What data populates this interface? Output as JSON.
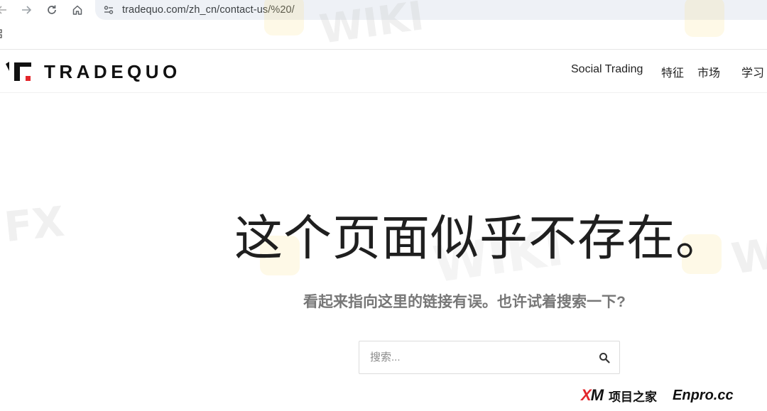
{
  "browser": {
    "url": "tradequo.com/zh_cn/contact-us/%20/",
    "icons": [
      "back-arrow-icon",
      "forward-arrow-icon",
      "reload-icon",
      "home-icon",
      "site-info-icon",
      "apps-grid-icon"
    ]
  },
  "header": {
    "logo_text": "TRADEQUO",
    "nav": {
      "social_trading": "Social Trading",
      "features": "特征",
      "markets": "市场",
      "learn": "学习"
    }
  },
  "main": {
    "headline": "这个页面似乎不存在。",
    "subtext": "看起来指向这里的链接有误。也许试着搜索一下?",
    "search": {
      "placeholder": "搜索..."
    }
  },
  "watermarks": {
    "fx": "FX",
    "wiki": "WIKI"
  },
  "badge": {
    "brand_x": "X",
    "brand_m": "M",
    "brand_cn": "项目之家",
    "site": "Enpro.cc"
  },
  "colors": {
    "logo_accent": "#e3262b",
    "subtext": "#777777",
    "omnibox_bg": "#eef1f6"
  }
}
